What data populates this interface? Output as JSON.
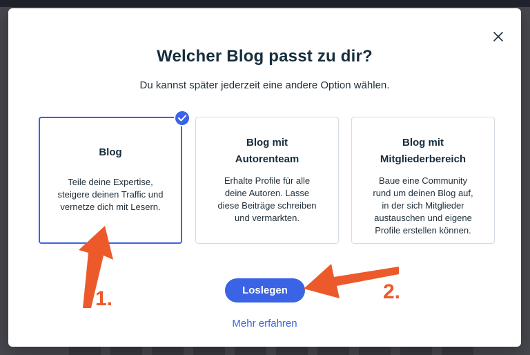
{
  "dialog": {
    "title": "Welcher Blog passt zu dir?",
    "subtitle": "Du kannst später jederzeit eine andere Option wählen."
  },
  "options": [
    {
      "title_lines": [
        "Blog"
      ],
      "desc_lines": [
        "Teile deine Expertise,",
        "steigere deinen Traffic und",
        "vernetze dich mit Lesern."
      ],
      "selected": true
    },
    {
      "title_lines": [
        "Blog mit",
        "Autorenteam"
      ],
      "desc_lines": [
        "Erhalte Profile für alle",
        "deine Autoren. Lasse",
        "diese Beiträge schreiben",
        "und vermarkten."
      ],
      "selected": false
    },
    {
      "title_lines": [
        "Blog mit",
        "Mitgliederbereich"
      ],
      "desc_lines": [
        "Baue eine Community",
        "rund um deinen Blog auf,",
        "in der sich Mitglieder",
        "austauschen und eigene",
        "Profile erstellen können."
      ],
      "selected": false
    }
  ],
  "actions": {
    "primary_label": "Loslegen",
    "secondary_link": "Mehr erfahren"
  },
  "annotations": {
    "step1": "1.",
    "step2": "2.",
    "color": "#ec5a2b"
  },
  "colors": {
    "accent": "#3b63e6",
    "heading": "#162d3d"
  },
  "icons": {
    "close": "close-icon",
    "selected": "checkmark-icon"
  }
}
